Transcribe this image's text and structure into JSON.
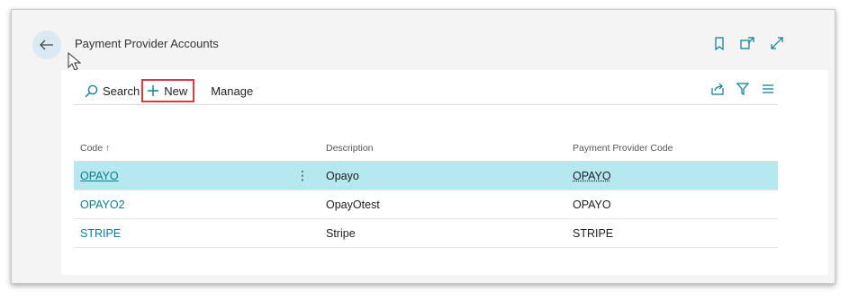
{
  "page": {
    "title": "Payment Provider Accounts"
  },
  "actions": {
    "search": "Search",
    "new": "New",
    "manage": "Manage"
  },
  "columns": {
    "code": "Code",
    "sort_indicator": "↑",
    "description": "Description",
    "payment_provider_code": "Payment Provider Code"
  },
  "rows": [
    {
      "code": "OPAYO",
      "description": "Opayo",
      "payment_provider_code": "OPAYO"
    },
    {
      "code": "OPAYO2",
      "description": "OpayOtest",
      "payment_provider_code": "OPAYO"
    },
    {
      "code": "STRIPE",
      "description": "Stripe",
      "payment_provider_code": "STRIPE"
    }
  ],
  "selected_row": 0,
  "icons": {
    "back": "back-arrow-icon",
    "bookmark": "bookmark-icon",
    "open_new": "open-in-new-window-icon",
    "expand": "expand-icon",
    "search": "search-icon",
    "plus": "plus-icon",
    "share": "share-icon",
    "filter": "filter-icon",
    "list": "list-view-icon",
    "more": "more-options-icon"
  },
  "colors": {
    "accent": "#0b7e8c",
    "selected_row": "#b6e8ef",
    "highlight_box": "#e03a3a"
  }
}
